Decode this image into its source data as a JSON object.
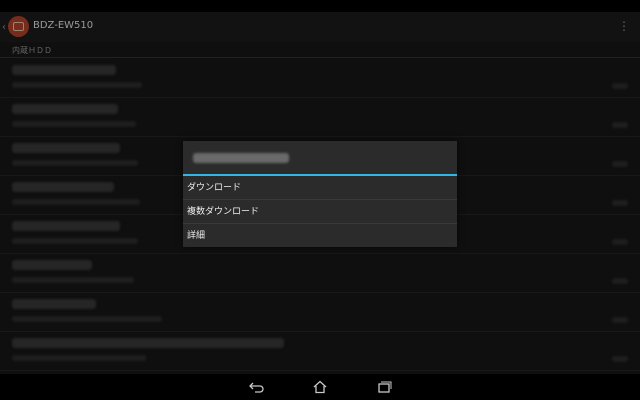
{
  "app": {
    "title": "BDZ-EW510",
    "section_label": "内蔵ＨＤＤ"
  },
  "list": {
    "items": [
      {
        "title_width": 104,
        "subtitle_width": 130
      },
      {
        "title_width": 106,
        "subtitle_width": 124
      },
      {
        "title_width": 108,
        "subtitle_width": 126
      },
      {
        "title_width": 102,
        "subtitle_width": 128
      },
      {
        "title_width": 108,
        "subtitle_width": 126
      },
      {
        "title_width": 80,
        "subtitle_width": 122
      },
      {
        "title_width": 84,
        "subtitle_width": 150
      },
      {
        "title_width": 272,
        "subtitle_width": 134
      }
    ]
  },
  "dialog": {
    "items": [
      {
        "label": "ダウンロード"
      },
      {
        "label": "複数ダウンロード"
      },
      {
        "label": "詳細"
      }
    ]
  },
  "colors": {
    "accent": "#33b5e5",
    "app_icon": "#b5452f"
  }
}
